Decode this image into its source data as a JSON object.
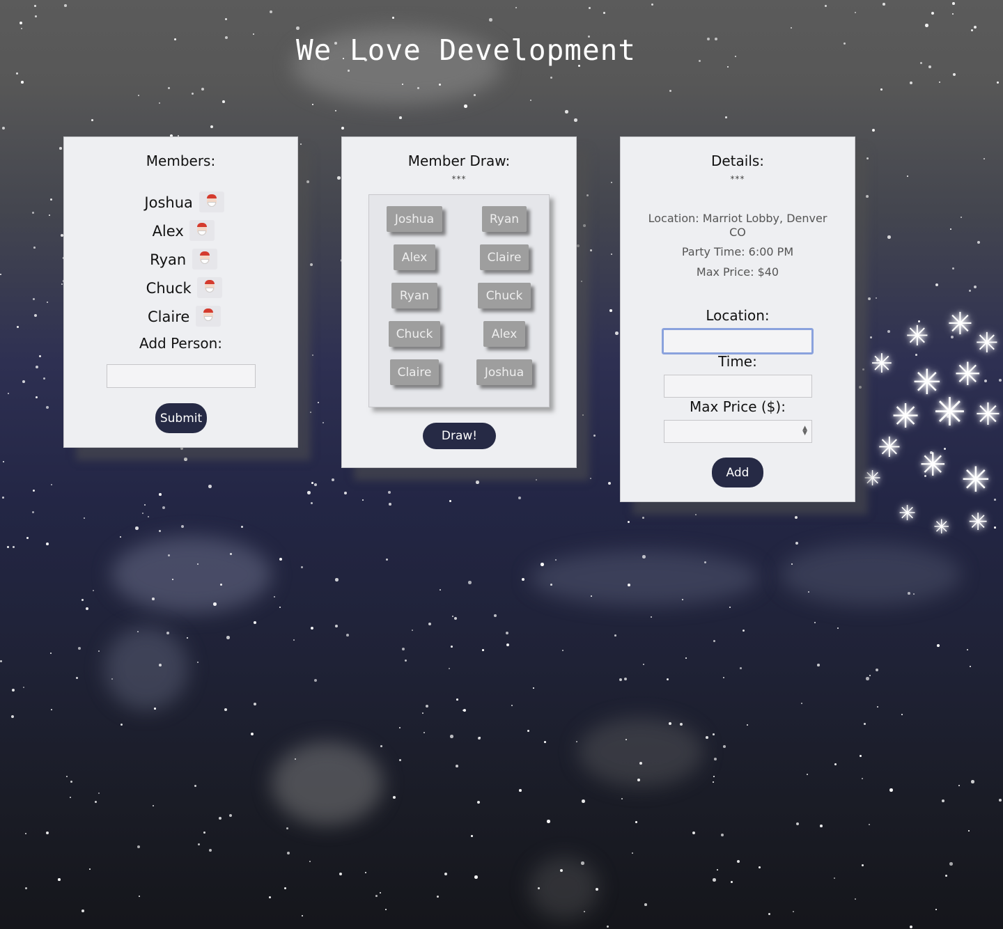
{
  "page_title": "We Love Development",
  "members_card": {
    "title": "Members:",
    "members": [
      "Joshua",
      "Alex",
      "Ryan",
      "Chuck",
      "Claire"
    ],
    "member_icon": "santa-icon",
    "add_label": "Add Person:",
    "add_input_value": "",
    "submit_label": "Submit"
  },
  "draw_card": {
    "title": "Member Draw:",
    "divider": "***",
    "pairs": [
      [
        "Joshua",
        "Ryan"
      ],
      [
        "Alex",
        "Claire"
      ],
      [
        "Ryan",
        "Chuck"
      ],
      [
        "Chuck",
        "Alex"
      ],
      [
        "Claire",
        "Joshua"
      ]
    ],
    "draw_label": "Draw!"
  },
  "details_card": {
    "title": "Details:",
    "divider": "***",
    "location_line": "Location: Marriot Lobby, Denver CO",
    "time_line": "Party Time: 6:00 PM",
    "price_line": "Max Price: $40",
    "location_label": "Location:",
    "location_value": "",
    "time_label": "Time:",
    "time_value": "",
    "price_label": "Max Price ($):",
    "price_value": "",
    "add_label": "Add"
  },
  "colors": {
    "button": "#262a45",
    "chip": "#9e9e9e",
    "focus_ring": "#8aa2dd"
  }
}
